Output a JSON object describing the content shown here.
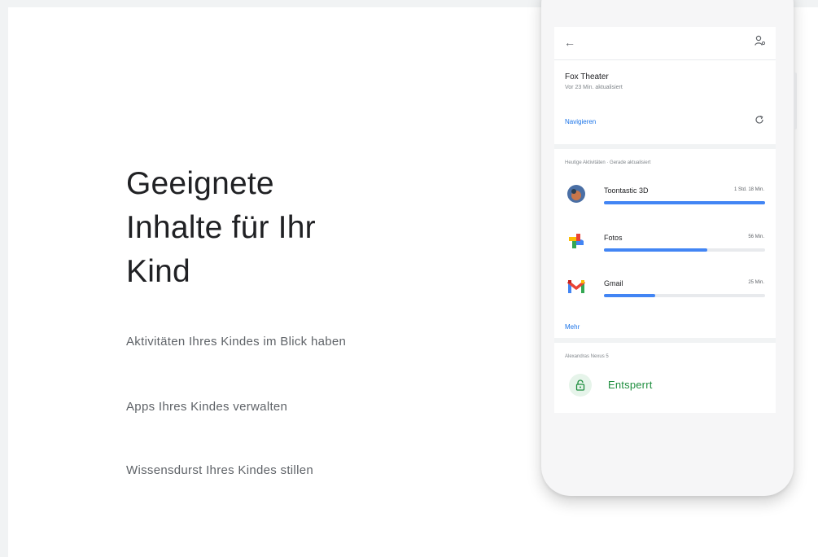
{
  "headline": "Geeignete\nInhalte für Ihr\nKind",
  "features": [
    "Aktivitäten Ihres Kindes im Blick haben",
    "Apps Ihres Kindes verwalten",
    "Wissensdurst Ihres Kindes stillen"
  ],
  "phone": {
    "location": {
      "place": "Fox Theater",
      "updated": "Vor 23 Min. aktualisiert",
      "navigate_label": "Navigieren"
    },
    "activity": {
      "label": "Heutige Aktivitäten · Gerade aktualisiert",
      "apps": [
        {
          "name": "Toontastic 3D",
          "time": "1 Std. 18 Min.",
          "progress": 1.0,
          "icon": "toontastic-app-icon"
        },
        {
          "name": "Fotos",
          "time": "56 Min.",
          "progress": 0.64,
          "icon": "photos-app-icon"
        },
        {
          "name": "Gmail",
          "time": "25 Min.",
          "progress": 0.32,
          "icon": "gmail-app-icon"
        }
      ],
      "more_label": "Mehr"
    },
    "device": {
      "label": "Alexandras Nexus 5",
      "status": "Entsperrt"
    }
  },
  "colors": {
    "accent": "#1a73e8",
    "progress": "#4285f4",
    "unlocked": "#1e8e3e"
  }
}
